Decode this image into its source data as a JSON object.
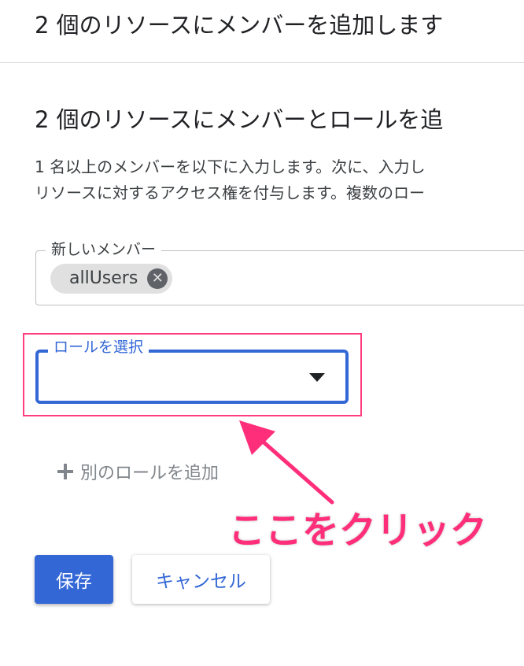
{
  "header": {
    "title": "2 個のリソースにメンバーを追加します"
  },
  "section": {
    "title": "2 個のリソースにメンバーとロールを追",
    "description_line1": "1 名以上のメンバーを以下に入力します。次に、入力し",
    "description_line2": "リソースに対するアクセス権を付与します。複数のロー"
  },
  "members_field": {
    "label": "新しいメンバー",
    "chips": [
      {
        "label": "allUsers"
      }
    ],
    "chip_remove_glyph": "✕"
  },
  "role_select": {
    "label": "ロールを選択",
    "value": ""
  },
  "add_role": {
    "label": "別のロールを追加"
  },
  "annotation": {
    "text": "ここをクリック",
    "color": "#ff2e7a"
  },
  "buttons": {
    "save": "保存",
    "cancel": "キャンセル"
  },
  "colors": {
    "accent": "#3367d6",
    "highlight": "#ff3d7f",
    "muted": "#80868b"
  }
}
